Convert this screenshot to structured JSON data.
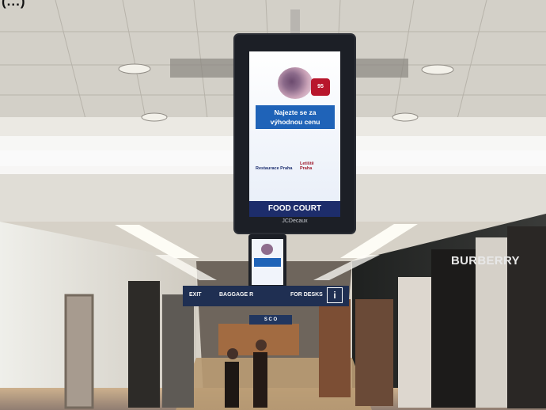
{
  "caption_fragment": "(...)",
  "digital_screen": {
    "headline": "Najezte se za",
    "subhead": "výhodnou cenu",
    "price_badge": "95",
    "left_logo": "Restaurace Praha",
    "right_logo_top": "Letiště",
    "right_logo_bottom": "Praha",
    "footer": "FOOD COURT",
    "brand": "JCDecaux"
  },
  "overhead_sign": {
    "exit": "EXIT",
    "baggage": "BAGGAGE R",
    "desks": "FOR DESKS",
    "info": "i"
  },
  "small_sign": "S C O",
  "storefront": "BURBERRY"
}
